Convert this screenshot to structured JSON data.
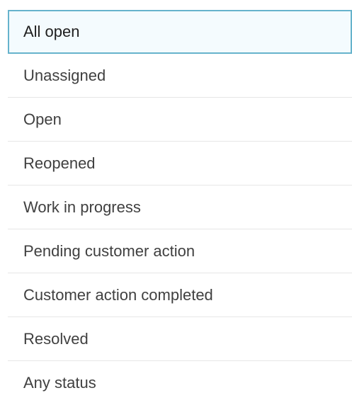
{
  "status_filter": {
    "selected_index": 0,
    "options": [
      {
        "label": "All open"
      },
      {
        "label": "Unassigned"
      },
      {
        "label": "Open"
      },
      {
        "label": "Reopened"
      },
      {
        "label": "Work in progress"
      },
      {
        "label": "Pending customer action"
      },
      {
        "label": "Customer action completed"
      },
      {
        "label": "Resolved"
      },
      {
        "label": "Any status"
      }
    ]
  }
}
